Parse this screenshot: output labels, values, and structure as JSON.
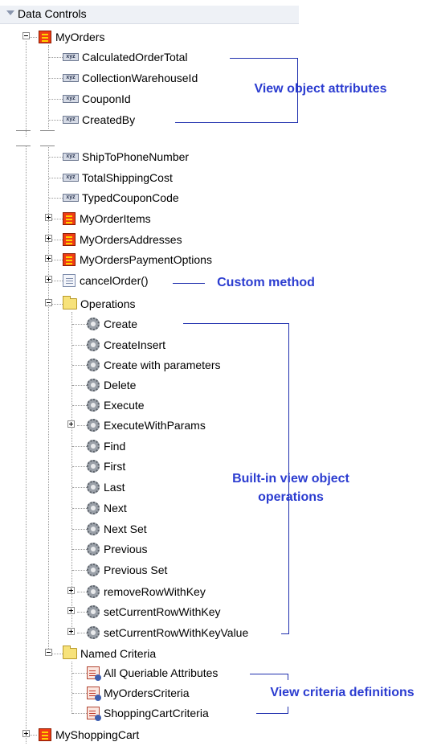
{
  "header": {
    "title": "Data Controls"
  },
  "tree": {
    "my_orders": "MyOrders",
    "attrs_top": [
      "CalculatedOrderTotal",
      "CollectionWarehouseId",
      "CouponId",
      "CreatedBy"
    ],
    "attrs_bottom": [
      "ShipToPhoneNumber",
      "TotalShippingCost",
      "TypedCouponCode"
    ],
    "child_vos": [
      "MyOrderItems",
      "MyOrdersAddresses",
      "MyOrdersPaymentOptions"
    ],
    "method": "cancelOrder()",
    "operations_folder": "Operations",
    "operations": [
      "Create",
      "CreateInsert",
      "Create with parameters",
      "Delete",
      "Execute",
      "ExecuteWithParams",
      "Find",
      "First",
      "Last",
      "Next",
      "Next Set",
      "Previous",
      "Previous Set",
      "removeRowWithKey",
      "setCurrentRowWithKey",
      "setCurrentRowWithKeyValue"
    ],
    "criteria_folder": "Named Criteria",
    "criteria": [
      "All Queriable Attributes",
      "MyOrdersCriteria",
      "ShoppingCartCriteria"
    ],
    "shopping_cart": "MyShoppingCart"
  },
  "callouts": {
    "view_object_attributes": "View object attributes",
    "custom_method": "Custom method",
    "builtin_ops_line1": "Built-in view object",
    "builtin_ops_line2": "operations",
    "view_criteria": "View criteria definitions"
  },
  "icons": {
    "view_object": "view-object-icon",
    "attribute": "attribute-icon",
    "method": "method-icon",
    "folder": "folder-icon",
    "operation": "gear-icon",
    "criteria": "view-criteria-icon"
  },
  "colors": {
    "callout_text": "#2b3cd0",
    "callout_line": "#1f2fae",
    "header_bg": "#eef1f6"
  }
}
